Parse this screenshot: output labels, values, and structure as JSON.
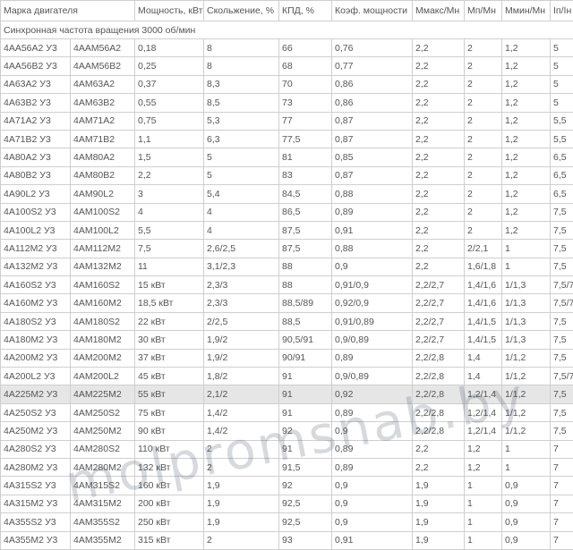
{
  "columns": [
    "Марка двигателя",
    "Мощность, кВт",
    "Скольжение, %",
    "КПД, %",
    "Коэф. мощности",
    "Ммакс/Мн",
    "Мп/Мн",
    "Ммин/Мн",
    "Iп/Iн"
  ],
  "section_title": "Синхронная частота вращения 3000 об/мин",
  "rows": [
    [
      "4АА56А2 У3",
      "4ААМ56А2",
      "0,18",
      "8",
      "66",
      "0,76",
      "2,2",
      "2",
      "1,2",
      "5"
    ],
    [
      "4АА56В2 У3",
      "4ААМ56В2",
      "0,25",
      "8",
      "68",
      "0,77",
      "2,2",
      "2",
      "1,2",
      "5"
    ],
    [
      "4А63А2 У3",
      "4АМ63А2",
      "0,37",
      "8,3",
      "70",
      "0,86",
      "2,2",
      "2",
      "1,2",
      "5"
    ],
    [
      "4А63В2 У3",
      "4АМ63В2",
      "0,55",
      "8,5",
      "73",
      "0,86",
      "2,2",
      "2",
      "1,2",
      "5"
    ],
    [
      "4А71А2 У3",
      "4АМ71А2",
      "0,75",
      "5,3",
      "77",
      "0,87",
      "2,2",
      "2",
      "1,2",
      "5,5"
    ],
    [
      "4А71В2 У3",
      "4АМ71В2",
      "1,1",
      "6,3",
      "77,5",
      "0,87",
      "2,2",
      "2",
      "1,2",
      "5,5"
    ],
    [
      "4А80А2 У3",
      "4АМ80А2",
      "1,5",
      "5",
      "81",
      "0,85",
      "2,2",
      "2",
      "1,2",
      "6,5"
    ],
    [
      "4А80В2 У3",
      "4АМ80В2",
      "2,2",
      "5",
      "83",
      "0,87",
      "2,2",
      "2",
      "1,2",
      "6,5"
    ],
    [
      "4А90L2 У3",
      "4АМ90L2",
      "3",
      "5,4",
      "84,5",
      "0,88",
      "2,2",
      "2",
      "1,2",
      "6,5"
    ],
    [
      "4А100S2 У3",
      "4АМ100S2",
      "4",
      "4",
      "86,5",
      "0,89",
      "2,2",
      "2",
      "1,2",
      "7,5"
    ],
    [
      "4А100L2 У3",
      "4АМ100L2",
      "5,5",
      "4",
      "87,5",
      "0,91",
      "2,2",
      "2",
      "1,2",
      "7,5"
    ],
    [
      "4А112М2 У3",
      "4АМ112М2",
      "7,5",
      "2,6/2,5",
      "87,5",
      "0,88",
      "2,2",
      "2/2,1",
      "1",
      "7,5"
    ],
    [
      "4А132М2 У3",
      "4АМ132М2",
      "11",
      "3,1/2,3",
      "88",
      "0,9",
      "2,2",
      "1,6/1,8",
      "1",
      "7,5"
    ],
    [
      "4А160S2 У3",
      "4АМ160S2",
      "15 кВт",
      "2,3/3",
      "88",
      "0,91/0,9",
      "2,2/2,7",
      "1,4/1,6",
      "1/1,3",
      "7,5/7"
    ],
    [
      "4А160М2 У3",
      "4АМ160М2",
      "18,5 кВт",
      "2,3/3",
      "88,5/89",
      "0,92/0,9",
      "2,2/2,7",
      "1,4/1,6",
      "1/1,3",
      "7,5/7"
    ],
    [
      "4А180S2 У3",
      "4АМ180S2",
      "22 кВт",
      "2/2,5",
      "88,5",
      "0,91/0,89",
      "2,2/2,7",
      "1,4/1,5",
      "1/1,3",
      "7,5"
    ],
    [
      "4А180М2 У3",
      "4АМ180М2",
      "30 кВт",
      "1,9/2",
      "90,5/91",
      "0,9/0,89",
      "2,2/2,7",
      "1,4/1,5",
      "1/1,3",
      "7,5"
    ],
    [
      "4А200М2 У3",
      "4АМ200М2",
      "37 кВт",
      "1,9/2",
      "90/91",
      "0,89",
      "2,2/2,8",
      "1,4",
      "1/1,2",
      "7,5"
    ],
    [
      "4А200L2 У3",
      "4АМ200L2",
      "45 кВт",
      "1,8/2",
      "91",
      "0,9/0,89",
      "2,2/2,8",
      "1,4",
      "1/1,2",
      "7,5/7"
    ],
    [
      "4А225М2 У3",
      "4АМ225М2",
      "55 кВт",
      "2,1/2",
      "91",
      "0,92",
      "2,2/2,8",
      "1,2/1,4",
      "1/1,2",
      "7,5"
    ],
    [
      "4А250S2 У3",
      "4АМ250S2",
      "75 кВт",
      "1,4/2",
      "91",
      "0,89",
      "2,2/2,8",
      "1,2/1,4",
      "1/1,2",
      "7,5"
    ],
    [
      "4А250М2 У3",
      "4АМ250М2",
      "90 кВт",
      "1,4/2",
      "92",
      "0,9",
      "2,2/2,8",
      "1,2/1,4",
      "1/1,2",
      "7,5"
    ],
    [
      "4А280S2 У3",
      "4АМ280S2",
      "110 кВт",
      "2",
      "91",
      "0,89",
      "2,2",
      "1,2",
      "1",
      "7"
    ],
    [
      "4А280М2 У3",
      "4АМ280М2",
      "132 кВт",
      "2",
      "91,5",
      "0,89",
      "2,2",
      "1,2",
      "1",
      "7"
    ],
    [
      "4А315S2 У3",
      "4АМ315S2",
      "160 кВт",
      "1,9",
      "92",
      "0,9",
      "1,9",
      "1",
      "0,9",
      "7"
    ],
    [
      "4А315М2 У3",
      "4АМ315М2",
      "200 кВт",
      "1,9",
      "92,5",
      "0,9",
      "1,9",
      "1",
      "0,9",
      "7"
    ],
    [
      "4А355S2 У3",
      "4АМ355S2",
      "250 кВт",
      "1,9",
      "92,5",
      "0,9",
      "1,9",
      "1",
      "0,9",
      "7"
    ],
    [
      "4А355М2 У3",
      "4АМ355М2",
      "315 кВт",
      "2",
      "93",
      "0,91",
      "1,9",
      "1",
      "0,9",
      "7"
    ]
  ],
  "highlighted_row": 19,
  "watermark": "molpromsnab.by"
}
